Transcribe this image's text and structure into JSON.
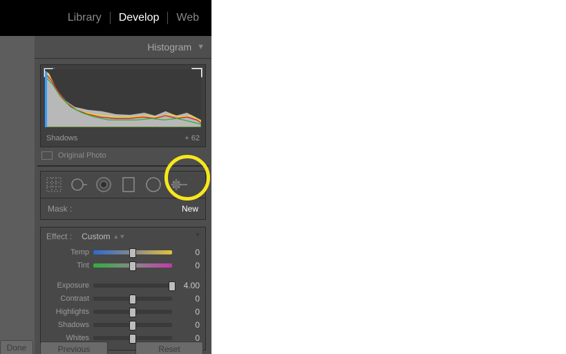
{
  "nav": {
    "library": "Library",
    "develop": "Develop",
    "web": "Web"
  },
  "histogram": {
    "title": "Histogram",
    "region_label": "Shadows",
    "region_value": "+ 62",
    "original_photo": "Original Photo"
  },
  "tools": {
    "mask_label": "Mask :",
    "mask_value": "New"
  },
  "effect": {
    "label": "Effect :",
    "preset": "Custom"
  },
  "sliders_a": [
    {
      "name": "Temp",
      "value": 0,
      "pos": 50,
      "track": "temp"
    },
    {
      "name": "Tint",
      "value": 0,
      "pos": 50,
      "track": "tint"
    }
  ],
  "sliders_b": [
    {
      "name": "Exposure",
      "value": "4.00",
      "pos": 100,
      "track": "plain"
    },
    {
      "name": "Contrast",
      "value": 0,
      "pos": 50,
      "track": "plain"
    },
    {
      "name": "Highlights",
      "value": 0,
      "pos": 50,
      "track": "plain"
    },
    {
      "name": "Shadows",
      "value": 0,
      "pos": 50,
      "track": "plain"
    },
    {
      "name": "Whites",
      "value": 0,
      "pos": 50,
      "track": "plain"
    }
  ],
  "buttons": {
    "done": "Done",
    "previous": "Previous",
    "reset": "Reset"
  }
}
